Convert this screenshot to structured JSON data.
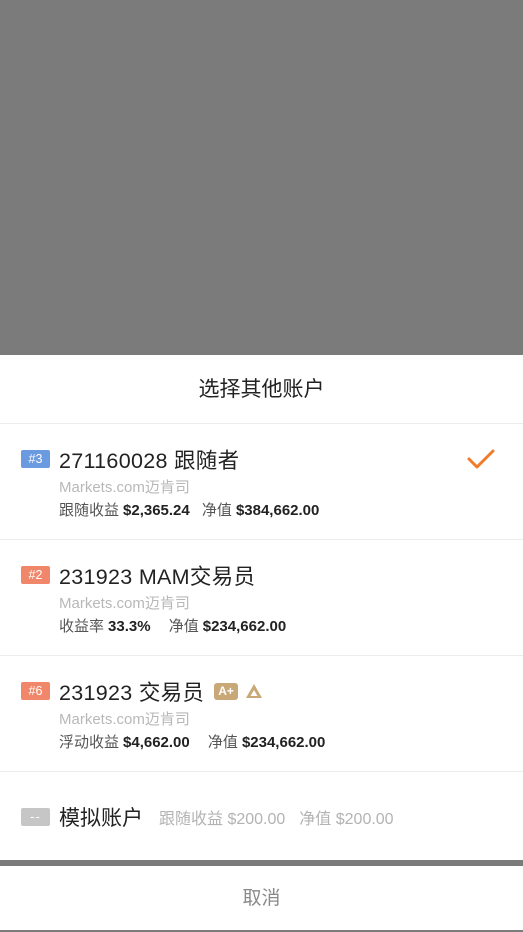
{
  "sheet": {
    "title": "选择其他账户"
  },
  "accounts": [
    {
      "rank": "#3",
      "rank_color": "#6a9ae0",
      "name": "271160028 跟随者",
      "broker": "Markets.com迈肯司",
      "stat1_label": "跟随收益",
      "stat1_value": "$2,365.24",
      "stat2_label": "净值",
      "stat2_value": "$384,662.00",
      "selected": true
    },
    {
      "rank": "#2",
      "rank_color": "#f0876a",
      "name": "231923 MAM交易员",
      "broker": "Markets.com迈肯司",
      "stat1_label": "收益率",
      "stat1_value": "33.3%",
      "stat2_label": "净值",
      "stat2_value": "$234,662.00",
      "selected": false
    },
    {
      "rank": "#6",
      "rank_color": "#f0876a",
      "name": "231923 交易员",
      "badge": "A+",
      "broker": "Markets.com迈肯司",
      "stat1_label": "浮动收益",
      "stat1_value": "$4,662.00",
      "stat2_label": "净值",
      "stat2_value": "$234,662.00",
      "selected": false
    }
  ],
  "demo": {
    "tag": "--",
    "name": "模拟账户",
    "stat1": "跟随收益 $200.00",
    "stat2": "净值 $200.00"
  },
  "cancel_label": "取消",
  "colors": {
    "accent": "#f07b2a",
    "gold": "#c9a878",
    "overlay": "#7b7b7b"
  },
  "icons": {
    "selected": "checkmark-icon",
    "tier": "triangle-rank-icon"
  }
}
